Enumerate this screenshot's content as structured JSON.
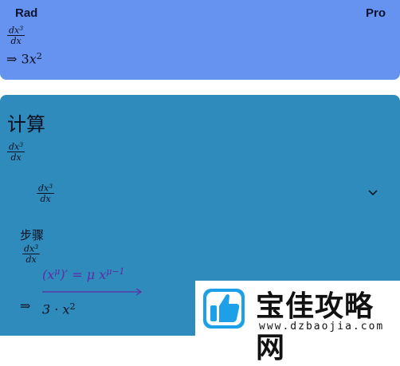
{
  "header": {
    "mode_left": "Rad",
    "mode_right": "Pro",
    "expression": {
      "numerator": "dx",
      "numerator_exp": "3",
      "denominator": "dx"
    },
    "result_arrow": "⇒",
    "result_coef": "3",
    "result_var": "x",
    "result_exp": "2"
  },
  "calculation": {
    "title": "计算",
    "expression": {
      "numerator": "dx",
      "numerator_exp": "3",
      "denominator": "dx"
    },
    "collapsible": {
      "numerator": "dx",
      "numerator_exp": "3",
      "denominator": "dx",
      "icon": "chevron-down-icon"
    },
    "steps_label": "步骤",
    "step_expression": {
      "numerator": "dx",
      "numerator_exp": "3",
      "denominator": "dx"
    },
    "rule": {
      "left": "(x",
      "left_exp": "μ",
      "right": ")′ = μ x",
      "right_exp": "μ−1"
    },
    "step_arrow": "⇒",
    "step_result": {
      "coef": "3 · x",
      "exp": "2"
    }
  },
  "watermark": {
    "title": "宝佳攻略网",
    "url": "www.dzbaojia.com",
    "icon": "thumbs-up-logo"
  },
  "colors": {
    "top_card": "#6593ef",
    "main_card": "#2e8bbb",
    "rule_purple": "#5f2ba6"
  }
}
